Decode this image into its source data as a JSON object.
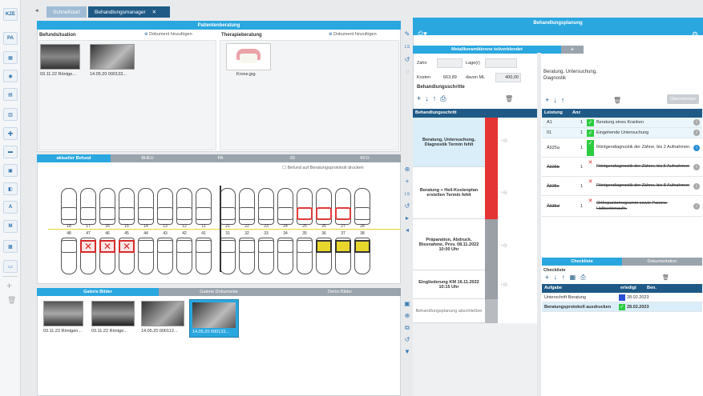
{
  "colors": {
    "accent": "#2aa7df",
    "dark_tab": "#1f5a86",
    "red": "#e23b3b",
    "green": "#2ecc40",
    "yellow": "#e8d62d"
  },
  "left_toolbar": [
    {
      "label": "KZE",
      "icon": "kze-icon"
    },
    {
      "label": "PA",
      "icon": "pa-icon"
    },
    {
      "label": "",
      "icon": "calendar-icon"
    },
    {
      "label": "",
      "icon": "tooth-icon"
    },
    {
      "label": "",
      "icon": "document-icon"
    },
    {
      "label": "",
      "icon": "invoice-icon"
    },
    {
      "label": "",
      "icon": "plus-icon"
    },
    {
      "label": "",
      "icon": "folder-icon"
    },
    {
      "label": "",
      "icon": "clipboard-icon"
    },
    {
      "label": "",
      "icon": "car-icon"
    },
    {
      "label": "",
      "icon": "abc-icon"
    },
    {
      "label": "",
      "icon": "meo-icon"
    },
    {
      "label": "",
      "icon": "image-icon"
    },
    {
      "label": "",
      "icon": "keyboard-icon"
    }
  ],
  "top_tabs": [
    {
      "label": "Schnellstart"
    },
    {
      "label": "Behandlungsmanager"
    }
  ],
  "patient": {
    "header": "Patientenberatung",
    "befund_title": "Befundsituation",
    "add_doc": "Dokument hinzufügen",
    "therapie_title": "Therapieberatung",
    "befund_images": [
      {
        "caption": "03.11.22 Röntge..."
      },
      {
        "caption": "14.05.20 000133..."
      }
    ],
    "therapie_images": [
      {
        "caption": "Krone.jpg"
      }
    ]
  },
  "chart": {
    "tabs": [
      "aktueller Befund",
      "BHEU",
      "PA",
      "ZE",
      "KFO"
    ],
    "checkbox_label": "Befund auf Beratungsprotokoll drucken",
    "upper_numbers": [
      "18",
      "17",
      "16",
      "15",
      "14",
      "13",
      "12",
      "11",
      "21",
      "22",
      "23",
      "24",
      "25",
      "26",
      "27",
      "28"
    ],
    "lower_numbers": [
      "48",
      "47",
      "46",
      "45",
      "44",
      "43",
      "42",
      "41",
      "31",
      "32",
      "33",
      "34",
      "35",
      "36",
      "37",
      "38"
    ]
  },
  "gallery": {
    "tabs": [
      "Galerie Bilder",
      "Galerie Dokumente",
      "Demo Bilder"
    ],
    "captions": [
      "03.11.22 Röntgen...",
      "03.11.22 Röntge...",
      "14.05.20 000112...",
      "14.05.20 000133..."
    ]
  },
  "planning": {
    "header": "Behandlungsplanung",
    "subtab": "Metallkeramikkrone teilverblendet",
    "zahn_label": "Zahn",
    "lage_label": "Lage(r)",
    "kosten_label": "Kosten",
    "kosten_value": "663,89",
    "davon_label": "davon ML",
    "davon_value": "400,00",
    "schritte_title": "Behandlungsschritte",
    "step_col": "Behandlungsschritt",
    "steps": [
      {
        "text": "Beratung, Untersuchung, Diagnostik Termin fehlt"
      },
      {
        "text": "Beratung + Heil-Kostenplan erstellen Termin fehlt"
      },
      {
        "text": "Präparation, Abdruck, Bissnahme, Prov. 08.11.2022 10:00 Uhr"
      },
      {
        "text": "Eingliederung KM 16.11.2022 10:15 Uhr"
      },
      {
        "text": "Behandlungsplanung abschließen"
      }
    ]
  },
  "services": {
    "title": "Beratung, Untersuchung, Diagnostik",
    "button": "Übernehmen",
    "col_leistung": "Leistung",
    "col_anz": "Anz",
    "rows": [
      {
        "code": "A1",
        "anz": "1",
        "desc": "Beratung eines Kranken"
      },
      {
        "code": "01",
        "anz": "1",
        "desc": "Eingehende Untersuchung"
      },
      {
        "code": "Ä925a",
        "anz": "1",
        "desc": "Röntgendiagnostik der Zähne, bis 2 Aufnahmen"
      },
      {
        "code": "Ä925b",
        "anz": "1",
        "desc": "Röntgendiagnostik der Zähne, bis 5 Aufnahmen"
      },
      {
        "code": "Ä925c",
        "anz": "1",
        "desc": "Röntgendiagnostik der Zähne, bis 8 Aufnahmen"
      },
      {
        "code": "Ä935d",
        "anz": "1",
        "desc": "Orthopantomogramm sowie Panora- Halbseitenaufn."
      }
    ]
  },
  "checklist": {
    "tabs": [
      "Checkliste",
      "Dokumentation"
    ],
    "title": "Checkliste",
    "col_aufgabe": "Aufgabe",
    "col_erledigt": "erledigt",
    "col_ben": "Ben.",
    "rows": [
      {
        "task": "Unterschrift Beratung",
        "date": "28.02.2023"
      },
      {
        "task": "Beratungsprotokoll ausdrucken",
        "date": "28.02.2023"
      }
    ]
  }
}
